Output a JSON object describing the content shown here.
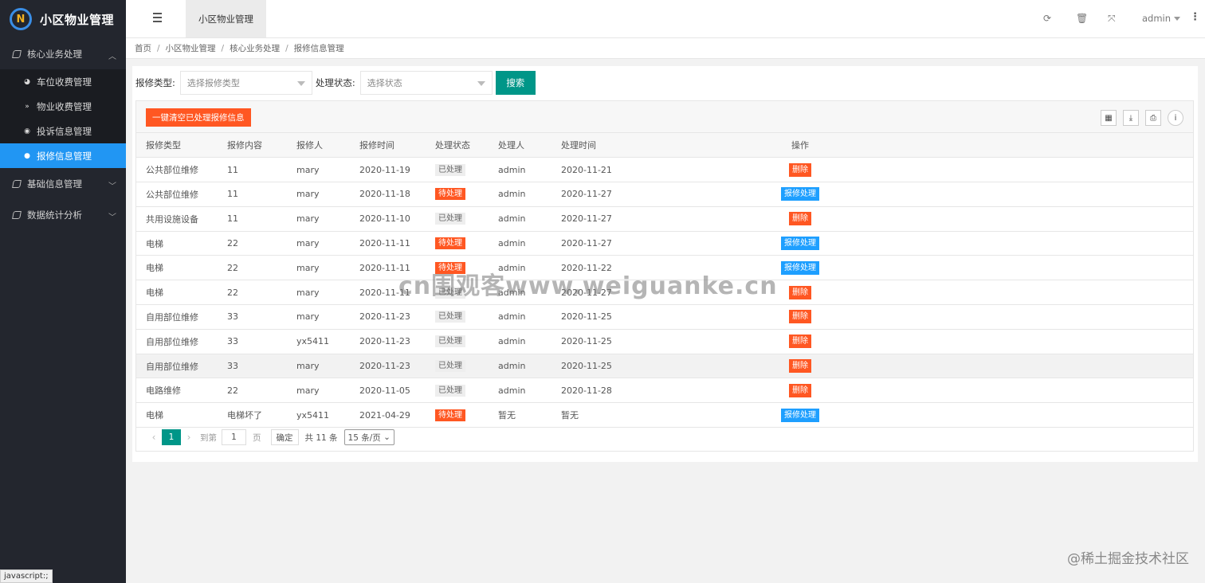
{
  "app": {
    "title": "小区物业管理",
    "logo_glyph": "N"
  },
  "sidebar": {
    "groups": [
      {
        "label": "核心业务处理",
        "expanded": true,
        "items": [
          {
            "label": "车位收费管理",
            "icon": "dashboard-icon"
          },
          {
            "label": "物业收费管理",
            "icon": "chevron-double-down-icon"
          },
          {
            "label": "投诉信息管理",
            "icon": "radio-circle-icon"
          },
          {
            "label": "报修信息管理",
            "icon": "dot-circle-icon",
            "active": true
          }
        ]
      },
      {
        "label": "基础信息管理",
        "expanded": false
      },
      {
        "label": "数据统计分析",
        "expanded": false
      }
    ],
    "status_tip": "javascript:;"
  },
  "header": {
    "tab": "小区物业管理",
    "user": "admin"
  },
  "breadcrumb": [
    "首页",
    "小区物业管理",
    "核心业务处理",
    "报修信息管理"
  ],
  "search": {
    "type_label": "报修类型:",
    "type_placeholder": "选择报修类型",
    "status_label": "处理状态:",
    "status_placeholder": "选择状态",
    "button": "搜索"
  },
  "toolbar": {
    "clear_button": "一键清空已处理报修信息"
  },
  "table": {
    "columns": [
      "报修类型",
      "报修内容",
      "报修人",
      "报修时间",
      "处理状态",
      "处理人",
      "处理时间",
      "操作"
    ],
    "rows": [
      {
        "type": "公共部位维修",
        "content": "11",
        "reporter": "mary",
        "time": "2020-11-19",
        "status": "已处理",
        "handler": "admin",
        "handled_time": "2020-11-21",
        "action": "删除"
      },
      {
        "type": "公共部位维修",
        "content": "11",
        "reporter": "mary",
        "time": "2020-11-18",
        "status": "待处理",
        "handler": "admin",
        "handled_time": "2020-11-27",
        "action": "报修处理"
      },
      {
        "type": "共用设施设备",
        "content": "11",
        "reporter": "mary",
        "time": "2020-11-10",
        "status": "已处理",
        "handler": "admin",
        "handled_time": "2020-11-27",
        "action": "删除"
      },
      {
        "type": "电梯",
        "content": "22",
        "reporter": "mary",
        "time": "2020-11-11",
        "status": "待处理",
        "handler": "admin",
        "handled_time": "2020-11-27",
        "action": "报修处理"
      },
      {
        "type": "电梯",
        "content": "22",
        "reporter": "mary",
        "time": "2020-11-11",
        "status": "待处理",
        "handler": "admin",
        "handled_time": "2020-11-22",
        "action": "报修处理"
      },
      {
        "type": "电梯",
        "content": "22",
        "reporter": "mary",
        "time": "2020-11-11",
        "status": "已处理",
        "handler": "admin",
        "handled_time": "2020-11-27",
        "action": "删除"
      },
      {
        "type": "自用部位维修",
        "content": "33",
        "reporter": "mary",
        "time": "2020-11-23",
        "status": "已处理",
        "handler": "admin",
        "handled_time": "2020-11-25",
        "action": "删除"
      },
      {
        "type": "自用部位维修",
        "content": "33",
        "reporter": "yx5411",
        "time": "2020-11-23",
        "status": "已处理",
        "handler": "admin",
        "handled_time": "2020-11-25",
        "action": "删除"
      },
      {
        "type": "自用部位维修",
        "content": "33",
        "reporter": "mary",
        "time": "2020-11-23",
        "status": "已处理",
        "handler": "admin",
        "handled_time": "2020-11-25",
        "action": "删除",
        "highlighted": true
      },
      {
        "type": "电路维修",
        "content": "22",
        "reporter": "mary",
        "time": "2020-11-05",
        "status": "已处理",
        "handler": "admin",
        "handled_time": "2020-11-28",
        "action": "删除"
      },
      {
        "type": "电梯",
        "content": "电梯坏了",
        "reporter": "yx5411",
        "time": "2021-04-29",
        "status": "待处理",
        "handler": "暂无",
        "handled_time": "暂无",
        "action": "报修处理"
      }
    ]
  },
  "pager": {
    "current": "1",
    "goto_label": "到第",
    "goto_value": "1",
    "page_unit": "页",
    "confirm": "确定",
    "total": "共 11 条",
    "page_size": "15 条/页"
  },
  "watermark": "cn围观客www.weiguanke.cn",
  "corner_watermark": "@稀土掘金技术社区",
  "colors": {
    "accent": "#009688",
    "danger": "#ff5722",
    "info": "#1e9fff",
    "active_nav": "#2196f3",
    "sidebar": "#23262e"
  }
}
